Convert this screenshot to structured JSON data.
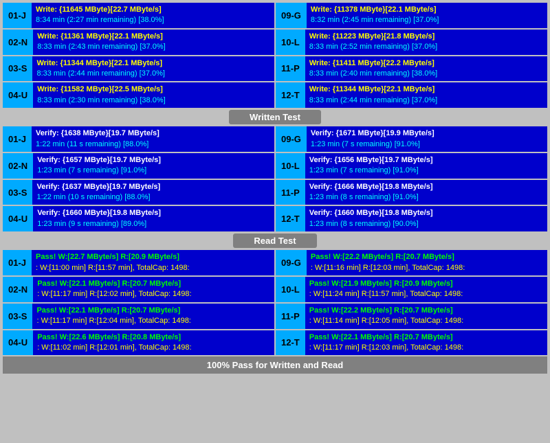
{
  "sections": {
    "write": {
      "label": "Written Test",
      "cells": [
        {
          "id": "01-J",
          "line1": "Write: {11645 MByte}[22.7 MByte/s]",
          "line2": "8:34 min (2:27 min remaining)  [38.0%]"
        },
        {
          "id": "09-G",
          "line1": "Write: {11378 MByte}[22.1 MByte/s]",
          "line2": "8:32 min (2:45 min remaining)  [37.0%]"
        },
        {
          "id": "02-N",
          "line1": "Write: {11361 MByte}[22.1 MByte/s]",
          "line2": "8:33 min (2:43 min remaining)  [37.0%]"
        },
        {
          "id": "10-L",
          "line1": "Write: {11223 MByte}[21.8 MByte/s]",
          "line2": "8:33 min (2:52 min remaining)  [37.0%]"
        },
        {
          "id": "03-S",
          "line1": "Write: {11344 MByte}[22.1 MByte/s]",
          "line2": "8:33 min (2:44 min remaining)  [37.0%]"
        },
        {
          "id": "11-P",
          "line1": "Write: {11411 MByte}[22.2 MByte/s]",
          "line2": "8:33 min (2:40 min remaining)  [38.0%]"
        },
        {
          "id": "04-U",
          "line1": "Write: {11582 MByte}[22.5 MByte/s]",
          "line2": "8:33 min (2:30 min remaining)  [38.0%]"
        },
        {
          "id": "12-T",
          "line1": "Write: {11344 MByte}[22.1 MByte/s]",
          "line2": "8:33 min (2:44 min remaining)  [37.0%]"
        }
      ]
    },
    "verify": {
      "label": "Written Test",
      "cells": [
        {
          "id": "01-J",
          "line1": "Verify: {1638 MByte}[19.7 MByte/s]",
          "line2": "1:22 min (11 s remaining)  [88.0%]"
        },
        {
          "id": "09-G",
          "line1": "Verify: {1671 MByte}[19.9 MByte/s]",
          "line2": "1:23 min (7 s remaining)  [91.0%]"
        },
        {
          "id": "02-N",
          "line1": "Verify: {1657 MByte}[19.7 MByte/s]",
          "line2": "1:23 min (7 s remaining)  [91.0%]"
        },
        {
          "id": "10-L",
          "line1": "Verify: {1656 MByte}[19.7 MByte/s]",
          "line2": "1:23 min (7 s remaining)  [91.0%]"
        },
        {
          "id": "03-S",
          "line1": "Verify: {1637 MByte}[19.7 MByte/s]",
          "line2": "1:22 min (10 s remaining)  [88.0%]"
        },
        {
          "id": "11-P",
          "line1": "Verify: {1666 MByte}[19.8 MByte/s]",
          "line2": "1:23 min (8 s remaining)  [91.0%]"
        },
        {
          "id": "04-U",
          "line1": "Verify: {1660 MByte}[19.8 MByte/s]",
          "line2": "1:23 min (9 s remaining)  [89.0%]"
        },
        {
          "id": "12-T",
          "line1": "Verify: {1660 MByte}[19.8 MByte/s]",
          "line2": "1:23 min (8 s remaining)  [90.0%]"
        }
      ]
    },
    "read": {
      "label": "Read Test",
      "cells": [
        {
          "id": "01-J",
          "line1": "Pass! W:[22.7 MByte/s] R:[20.9 MByte/s]",
          "line2": ": W:[11:00 min] R:[11:57 min], TotalCap: 1498:"
        },
        {
          "id": "09-G",
          "line1": "Pass! W:[22.2 MByte/s] R:[20.7 MByte/s]",
          "line2": ": W:[11:16 min] R:[12:03 min], TotalCap: 1498:"
        },
        {
          "id": "02-N",
          "line1": "Pass! W:[22.1 MByte/s] R:[20.7 MByte/s]",
          "line2": ": W:[11:17 min] R:[12:02 min], TotalCap: 1498:"
        },
        {
          "id": "10-L",
          "line1": "Pass! W:[21.9 MByte/s] R:[20.9 MByte/s]",
          "line2": ": W:[11:24 min] R:[11:57 min], TotalCap: 1498:"
        },
        {
          "id": "03-S",
          "line1": "Pass! W:[22.1 MByte/s] R:[20.7 MByte/s]",
          "line2": ": W:[11:17 min] R:[12:04 min], TotalCap: 1498:"
        },
        {
          "id": "11-P",
          "line1": "Pass! W:[22.2 MByte/s] R:[20.7 MByte/s]",
          "line2": ": W:[11:14 min] R:[12:05 min], TotalCap: 1498:"
        },
        {
          "id": "04-U",
          "line1": "Pass! W:[22.6 MByte/s] R:[20.8 MByte/s]",
          "line2": ": W:[11:02 min] R:[12:01 min], TotalCap: 1498:"
        },
        {
          "id": "12-T",
          "line1": "Pass! W:[22.1 MByte/s] R:[20.7 MByte/s]",
          "line2": ": W:[11:17 min] R:[12:03 min], TotalCap: 1498:"
        }
      ]
    }
  },
  "dividers": {
    "written": "Written Test",
    "read": "Read Test"
  },
  "footer": "100% Pass for Written and Read"
}
